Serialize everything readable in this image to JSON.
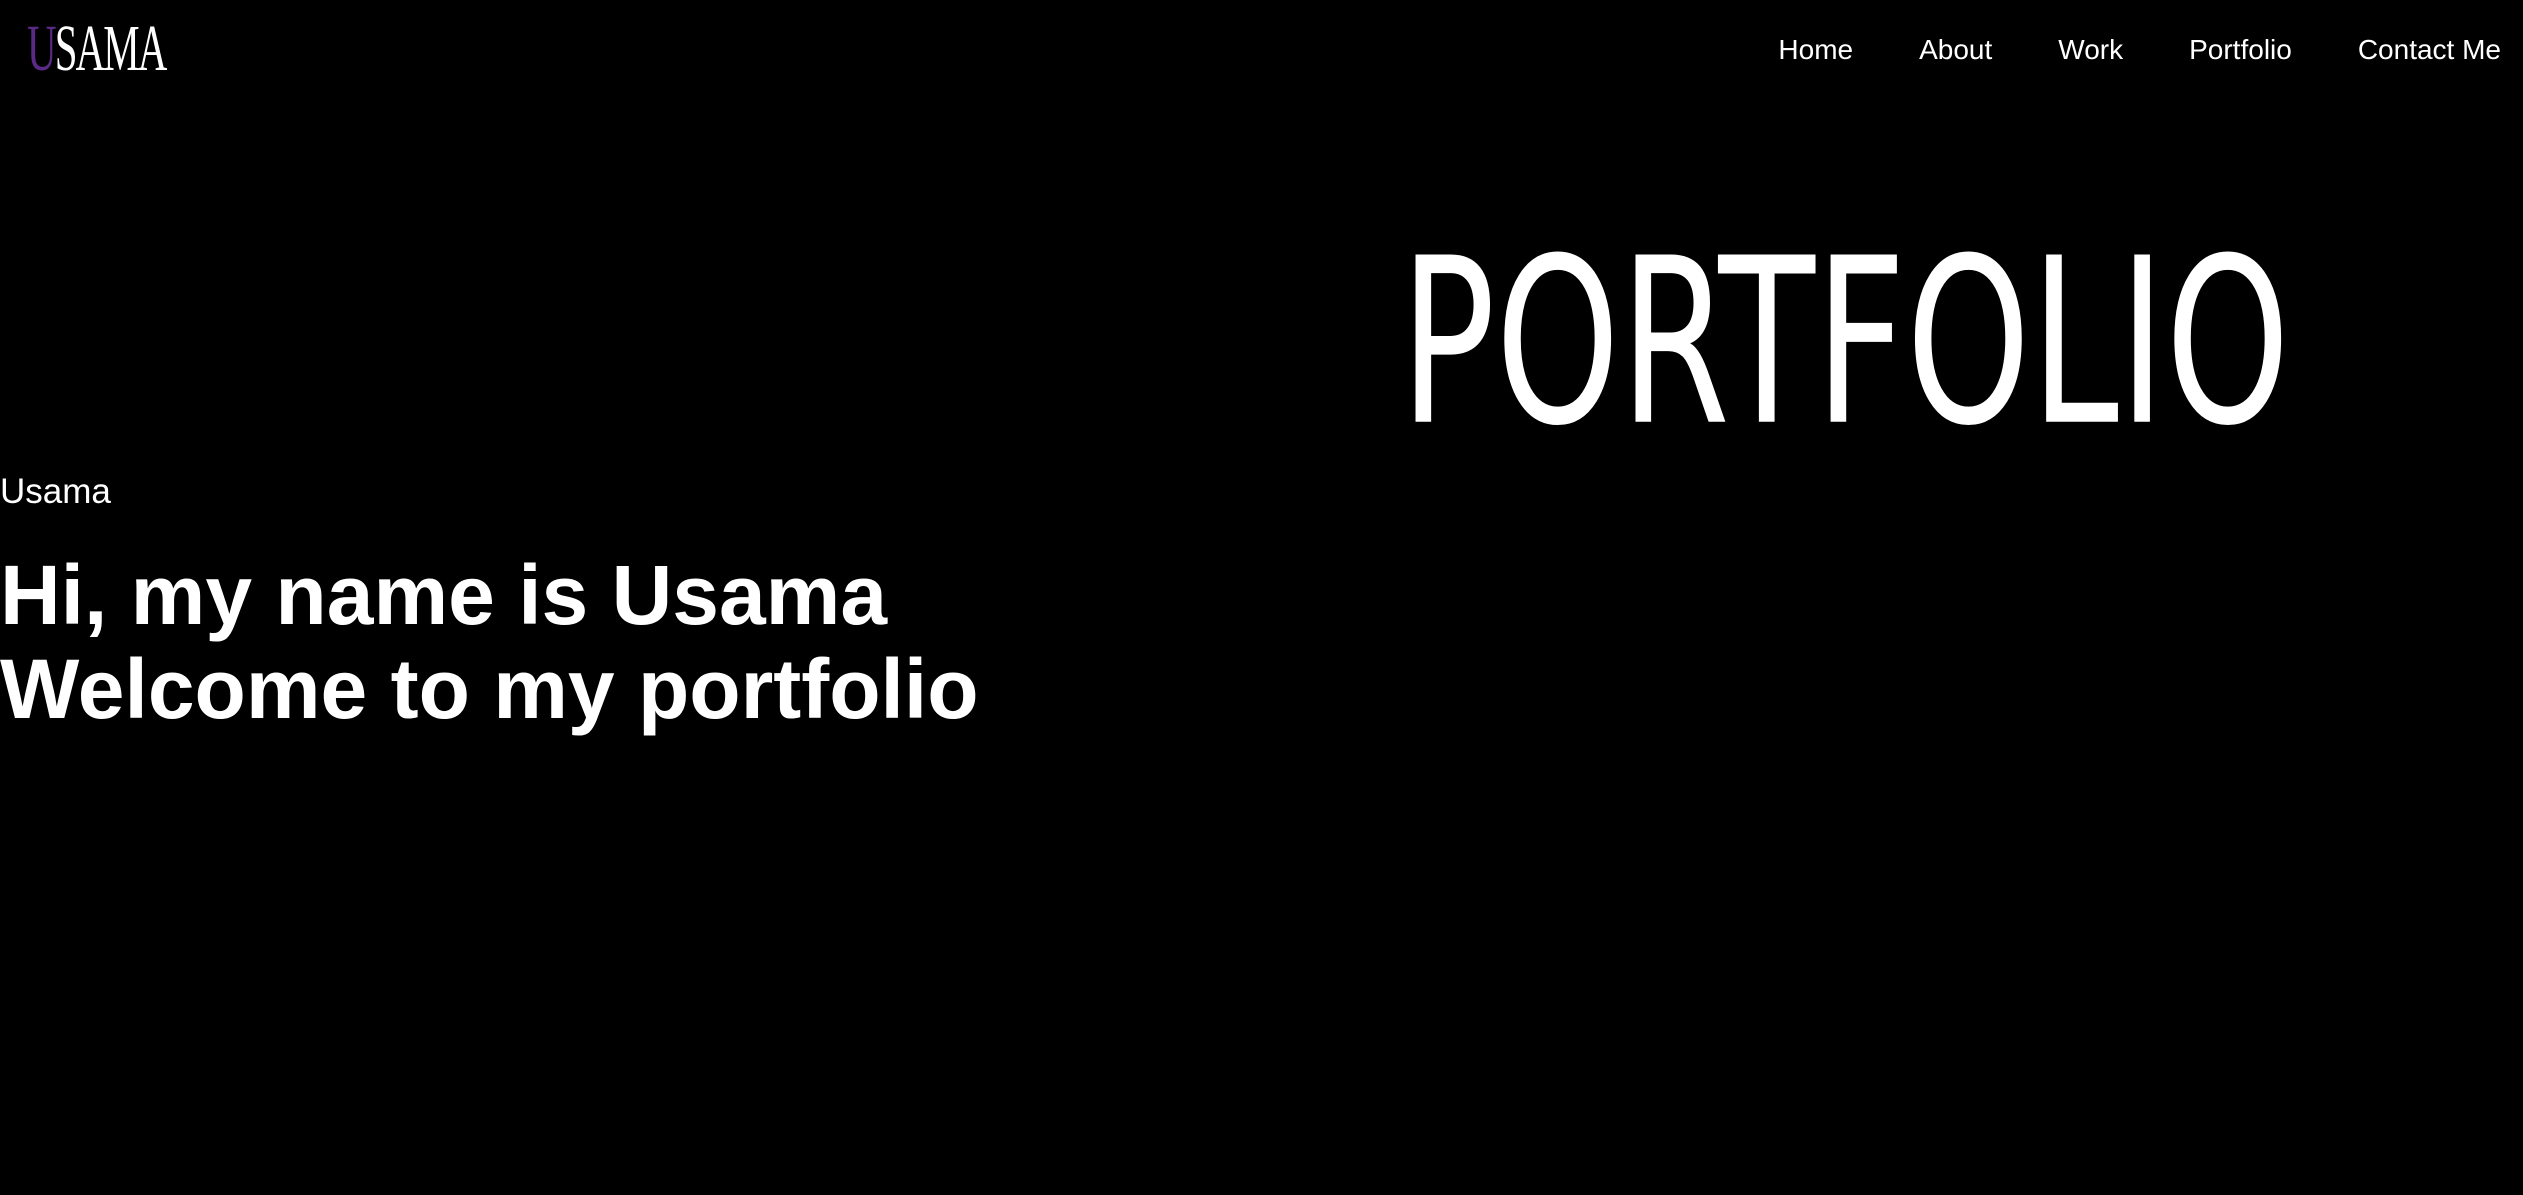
{
  "logo": {
    "first_letter": "U",
    "rest": "SAMA",
    "accent_color": "#5b2a86"
  },
  "nav": {
    "items": [
      {
        "label": "Home"
      },
      {
        "label": "About"
      },
      {
        "label": "Work"
      },
      {
        "label": "Portfolio"
      },
      {
        "label": "Contact Me"
      }
    ]
  },
  "hero": {
    "subtitle": "Usama",
    "title_line1": "Hi, my name is Usama",
    "title_line2": "Welcome to my portfolio"
  },
  "graphic": {
    "text": "PORTFOLIO"
  },
  "colors": {
    "background": "#000000",
    "text": "#ffffff"
  }
}
